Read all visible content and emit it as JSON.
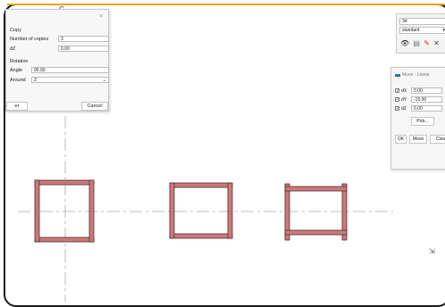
{
  "copy_dialog": {
    "close": "×",
    "title": "Copy",
    "copies_label": "Number of copies",
    "copies_value": "3",
    "dz_label": "dZ",
    "dz_value": "0.00",
    "rotation_header": "Rotation",
    "angle_label": "Angle",
    "angle_value": "90.00",
    "around_label": "Around",
    "around_value": "Z",
    "ok_button": "er",
    "cancel_button": "Cancel"
  },
  "view_toolbar": {
    "view_select": "3d",
    "style_select": "standard",
    "icons": [
      "eye-icon",
      "layers-icon",
      "paint-icon",
      "close-icon"
    ]
  },
  "move_linear": {
    "title": "Move - Linear",
    "dx": {
      "label": "dX",
      "value": "0.00",
      "checked": true
    },
    "dy": {
      "label": "dY",
      "value": "-15.00",
      "checked": true
    },
    "dz": {
      "label": "dZ",
      "value": "0.00",
      "checked": true
    },
    "pick_button": "Pick...",
    "ok_button": "OK",
    "move_button": "Move",
    "clear_button": "Clea"
  },
  "axis_label": "C",
  "colors": {
    "frame_fill": "#c97a7a",
    "frame_stroke": "#5a2a2a",
    "accent": "#e8a317",
    "grid_line": "#a8a8a8"
  }
}
